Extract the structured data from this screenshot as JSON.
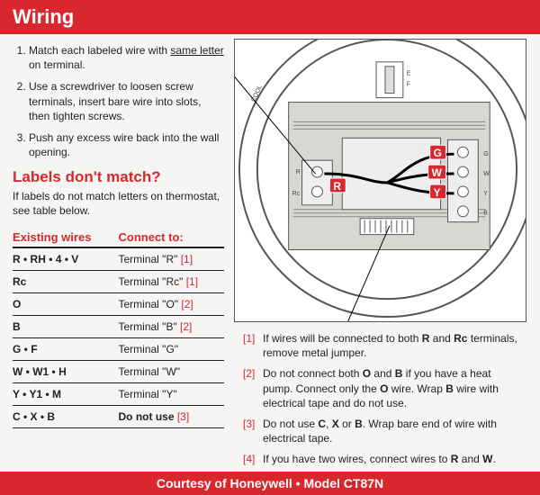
{
  "header": "Wiring",
  "instructions": [
    {
      "pre": "Match each labeled wire with ",
      "u": "same letter",
      "post": " on terminal."
    },
    {
      "text": "Use a screwdriver to loosen screw terminals, insert bare wire into slots, then tighten screws."
    },
    {
      "text": "Push any excess wire back into the wall opening."
    }
  ],
  "mismatch": {
    "heading": "Labels don't match?",
    "sub": "If labels do not match letters on thermostat, see table below."
  },
  "table": {
    "headers": [
      "Existing wires",
      "Connect to:"
    ],
    "rows": [
      {
        "wires": "R • RH • 4 • V",
        "connect": "Terminal \"R\"",
        "ref": "[1]"
      },
      {
        "wires": "Rc",
        "connect": "Terminal \"Rc\"",
        "ref": "[1]"
      },
      {
        "wires": "O",
        "connect": "Terminal \"O\"",
        "ref": "[2]"
      },
      {
        "wires": "B",
        "connect": "Terminal \"B\"",
        "ref": "[2]"
      },
      {
        "wires": "G • F",
        "connect": "Terminal \"G\"",
        "ref": ""
      },
      {
        "wires": "W • W1 • H",
        "connect": "Terminal \"W\"",
        "ref": ""
      },
      {
        "wires": "Y • Y1 • M",
        "connect": "Terminal \"Y\"",
        "ref": ""
      },
      {
        "wires": "C • X • B",
        "connect": "Do not use",
        "ref": "[3]",
        "connect_bold": true
      }
    ]
  },
  "diagram": {
    "terminal_labels_left": [
      "R",
      "Rc"
    ],
    "terminal_labels_right_column": [
      "G",
      "W",
      "Y",
      "B"
    ],
    "side_text_left": "COOL",
    "side_text_right_top": "E F",
    "wire_tags": [
      "R",
      "G",
      "W",
      "Y"
    ]
  },
  "notes": [
    {
      "ref": "[1]",
      "html": "If wires will be connected to both <b>R</b> and <b>Rc</b> terminals, remove metal jumper."
    },
    {
      "ref": "[2]",
      "html": "Do not connect both <b>O</b> and <b>B</b> if you have a heat pump. Connect only the <b>O</b> wire. Wrap <b>B</b> wire with electrical tape and do not use."
    },
    {
      "ref": "[3]",
      "html": "Do not use <b>C</b>, <b>X</b> or <b>B</b>. Wrap bare end of wire with electrical tape."
    },
    {
      "ref": "[4]",
      "html": "If you have two wires, connect wires to <b>R</b> and <b>W</b>."
    }
  ],
  "footer": "Courtesy of Honeywell • Model CT87N"
}
